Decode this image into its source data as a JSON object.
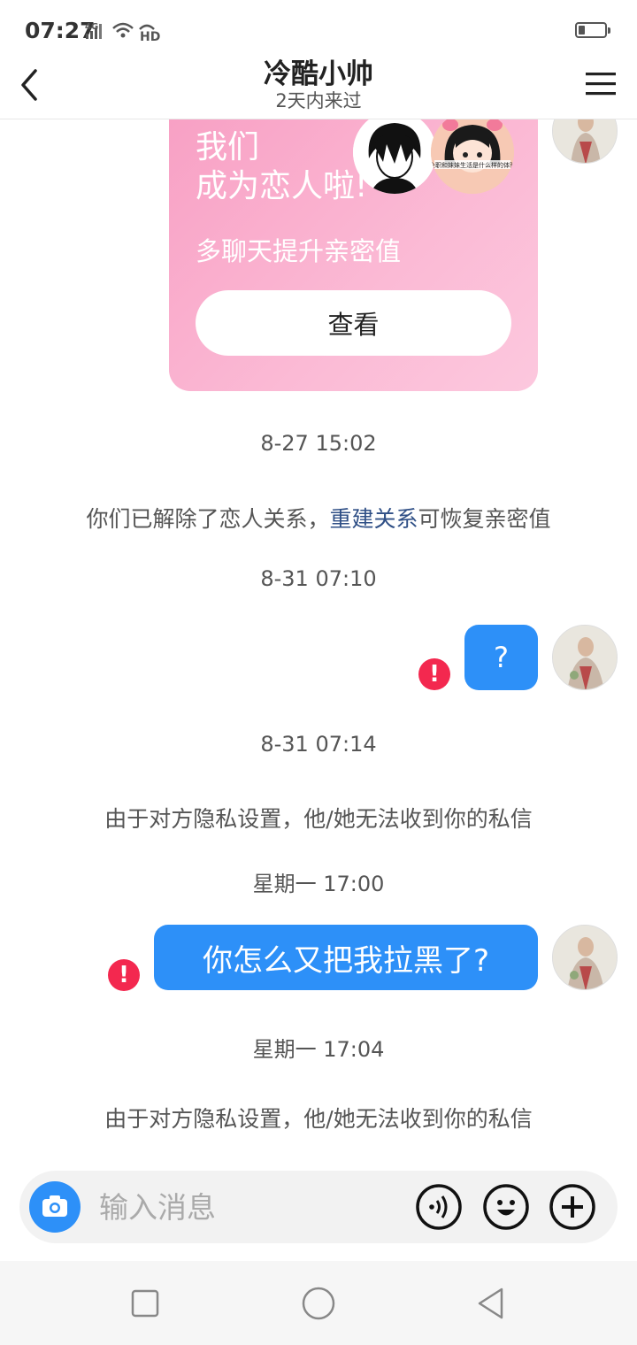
{
  "status_bar": {
    "time": "07:27",
    "network": "4G",
    "hd": "HD",
    "battery_level": 0.22
  },
  "header": {
    "title": "冷酷小帅",
    "subtitle": "2天内来过"
  },
  "card": {
    "title_line1": "我们",
    "title_line2": "成为恋人啦!",
    "subtitle": "多聊天提升亲密值",
    "button_label": "查看",
    "avatar2_caption": "全职和妹妹生活是什么样的体验"
  },
  "messages": {
    "time1": "8-27 15:02",
    "system1_prefix": "你们已解除了恋人关系，",
    "system1_link": "重建关系",
    "system1_suffix": "可恢复亲密值",
    "time2": "8-31 07:10",
    "msg1": "?",
    "time3": "8-31 07:14",
    "system2": "由于对方隐私设置，他/她无法收到你的私信",
    "time4": "星期一 17:00",
    "msg2": "你怎么又把我拉黑了?",
    "time5": "星期一 17:04",
    "system3": "由于对方隐私设置，他/她无法收到你的私信",
    "error_mark": "!"
  },
  "input": {
    "placeholder": "输入消息"
  },
  "colors": {
    "accent": "#2d90f8",
    "error": "#f3284f",
    "link": "#2f4f86",
    "card_pink": "#f8a0c4"
  }
}
